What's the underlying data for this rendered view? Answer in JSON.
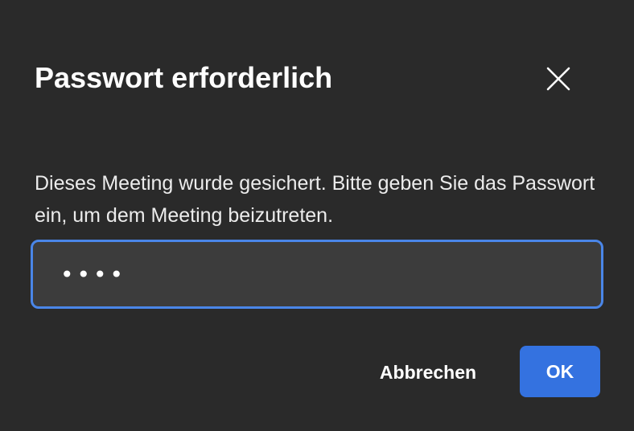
{
  "dialog": {
    "title": "Passwort erforderlich",
    "message": "Dieses Meeting wurde gesichert. Bitte geben Sie das Passwort ein, um dem Meeting beizutreten.",
    "password_masked": "••••",
    "close_icon": "close-icon",
    "cancel_label": "Abbrechen",
    "ok_label": "OK"
  },
  "colors": {
    "background": "#2a2a2a",
    "field_background": "#3c3c3c",
    "focus_border": "#4a86e8",
    "primary_button": "#3472e0",
    "text": "#ffffff"
  }
}
